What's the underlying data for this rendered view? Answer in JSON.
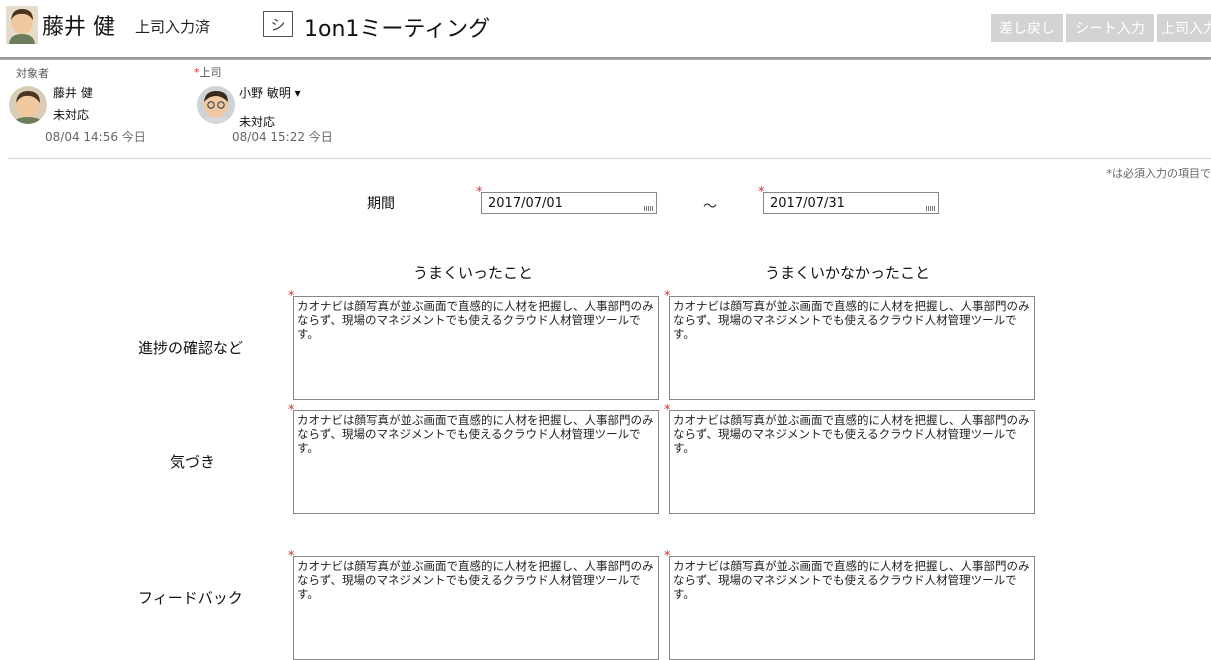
{
  "header": {
    "employee_name": "藤井 健",
    "status": "上司入力済",
    "sheet_icon": "シ",
    "sheet_title": "1on1ミーティング",
    "buttons": [
      "差し戻し",
      "シート入力",
      "上司入力"
    ]
  },
  "target_person": {
    "label": "対象者",
    "name": "藤井 健",
    "status": "未対応",
    "timestamp": "08/04 14:56 今日"
  },
  "supervisor": {
    "required_mark": "*",
    "label": "上司",
    "name": "小野 敏明 ▾",
    "status": "未対応",
    "timestamp": "08/04 15:22 今日"
  },
  "required_note": "*は必須入力の項目で",
  "period": {
    "label": "期間",
    "start": "2017/07/01",
    "separator": "〜",
    "end": "2017/07/31"
  },
  "columns": [
    "うまくいったこと",
    "うまくいかなかったこと"
  ],
  "rows": [
    {
      "label": "進捗の確認など",
      "cells": [
        "カオナビは顔写真が並ぶ画面で直感的に人材を把握し、人事部門のみならず、現場のマネジメントでも使えるクラウド人材管理ツールです。",
        "カオナビは顔写真が並ぶ画面で直感的に人材を把握し、人事部門のみならず、現場のマネジメントでも使えるクラウド人材管理ツールです。"
      ]
    },
    {
      "label": "気づき",
      "cells": [
        "カオナビは顔写真が並ぶ画面で直感的に人材を把握し、人事部門のみならず、現場のマネジメントでも使えるクラウド人材管理ツールです。",
        "カオナビは顔写真が並ぶ画面で直感的に人材を把握し、人事部門のみならず、現場のマネジメントでも使えるクラウド人材管理ツールです。"
      ]
    },
    {
      "label": "フィードバック",
      "cells": [
        "カオナビは顔写真が並ぶ画面で直感的に人材を把握し、人事部門のみならず、現場のマネジメントでも使えるクラウド人材管理ツールです。",
        "カオナビは顔写真が並ぶ画面で直感的に人材を把握し、人事部門のみならず、現場のマネジメントでも使えるクラウド人材管理ツールです。"
      ]
    }
  ],
  "colors": {
    "required": "#e03030",
    "button_disabled": "#d3d3d3"
  }
}
